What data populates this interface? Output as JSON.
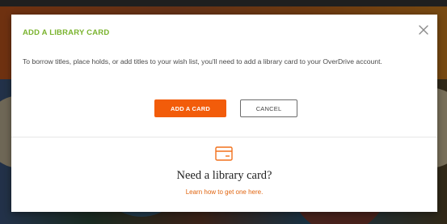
{
  "modal": {
    "title": "ADD A LIBRARY CARD",
    "body": "To borrow titles, place holds, or add titles to your wish list, you'll need to add a library card to your OverDrive account.",
    "add_button": "ADD A CARD",
    "cancel_button": "CANCEL",
    "need_card_heading": "Need a library card?",
    "learn_link": "Learn how to get one here."
  },
  "icons": {
    "close": "close-icon",
    "library_card": "library-card-icon"
  },
  "colors": {
    "title_green": "#7ab32e",
    "accent_orange": "#f25c0a",
    "link_orange": "#e0640f"
  }
}
